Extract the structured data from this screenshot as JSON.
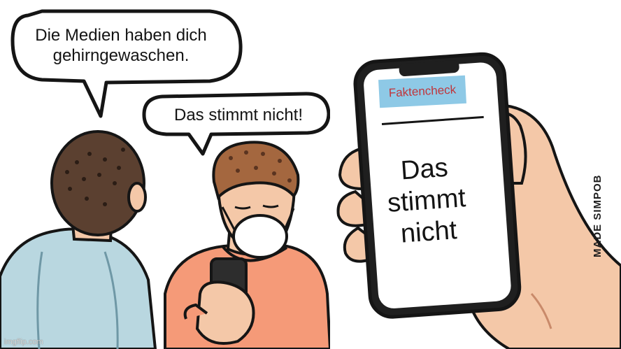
{
  "meme": {
    "bubble_left": "Die Medien haben dich gehirngewaschen.",
    "bubble_right": "Das stimmt nicht!",
    "phone_header": "Faktencheck",
    "phone_body": "Das stimmt nicht",
    "artist_signature": "MADE SIMPOB",
    "watermark": "imgflip.com"
  },
  "colors": {
    "shirt_left": "#b9d7e0",
    "shirt_right": "#f59a78",
    "hair": "#5b4030",
    "skin": "#f4c8a8",
    "phone_header_bg": "#8ec9e6",
    "phone_header_text": "#c0353b"
  }
}
